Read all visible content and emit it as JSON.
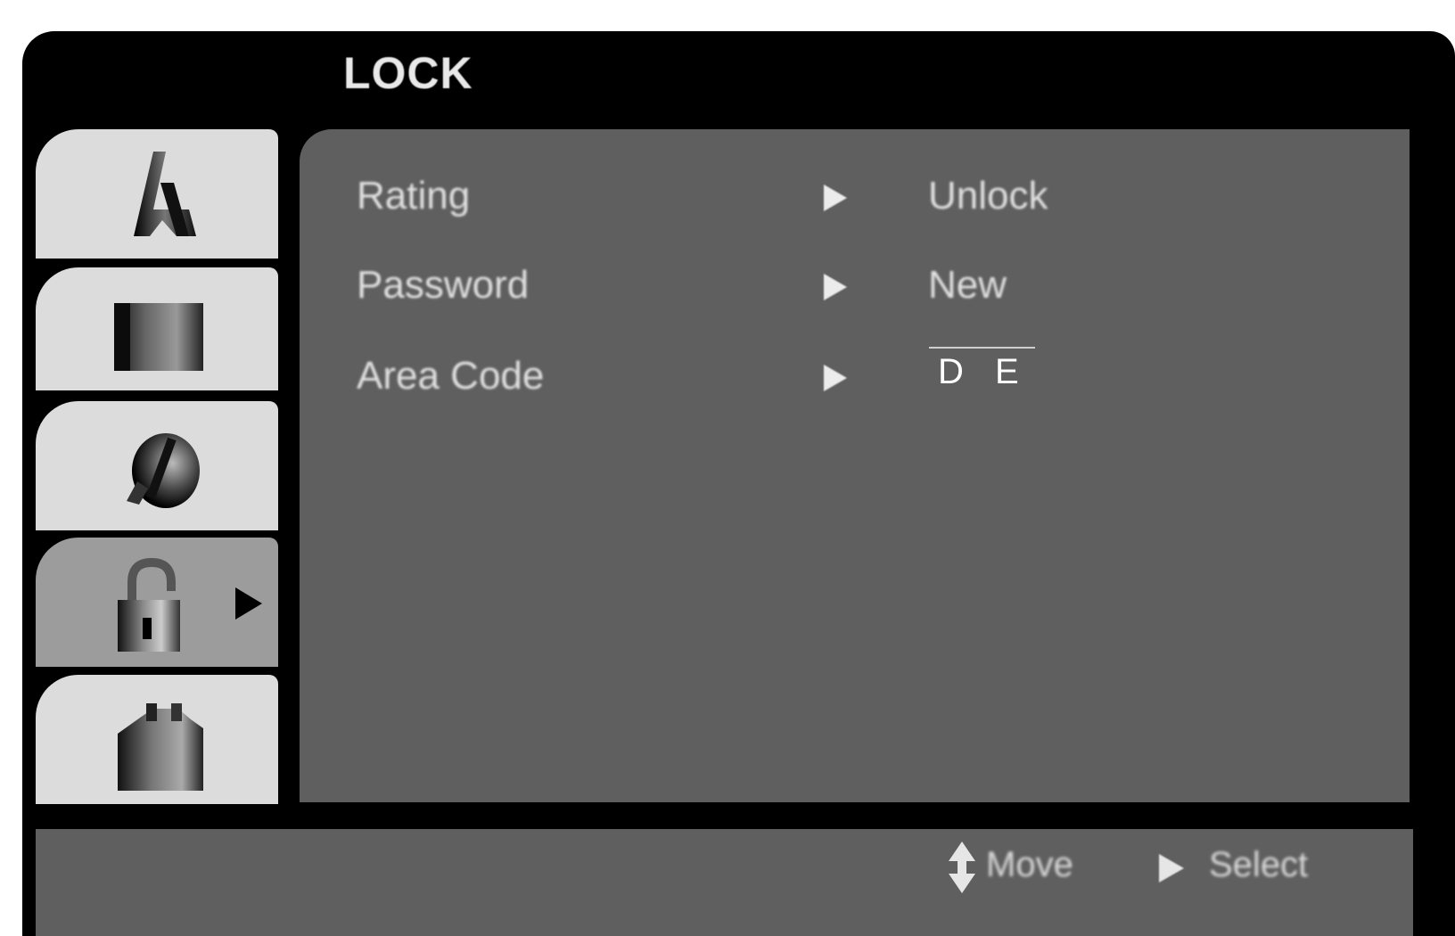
{
  "menu": {
    "title": "LOCK"
  },
  "sidebar": {
    "tabs": [
      {
        "name": "language",
        "icon": "language-a-icon",
        "selected": false
      },
      {
        "name": "display",
        "icon": "display-screen-icon",
        "selected": false
      },
      {
        "name": "audio",
        "icon": "audio-note-icon",
        "selected": false
      },
      {
        "name": "lock",
        "icon": "lock-icon",
        "selected": true
      },
      {
        "name": "others",
        "icon": "others-icon",
        "selected": false
      }
    ]
  },
  "settings": [
    {
      "label": "Rating",
      "value": "Unlock"
    },
    {
      "label": "Password",
      "value": "New"
    },
    {
      "label": "Area Code",
      "value": "D E"
    }
  ],
  "footer": {
    "move_label": "Move",
    "select_label": "Select"
  },
  "colors": {
    "background": "#000000",
    "panel": "#5f5f5f",
    "tab": "#dcdcdc",
    "tab_selected": "#9c9c9c",
    "text": "#e0e0e0"
  }
}
